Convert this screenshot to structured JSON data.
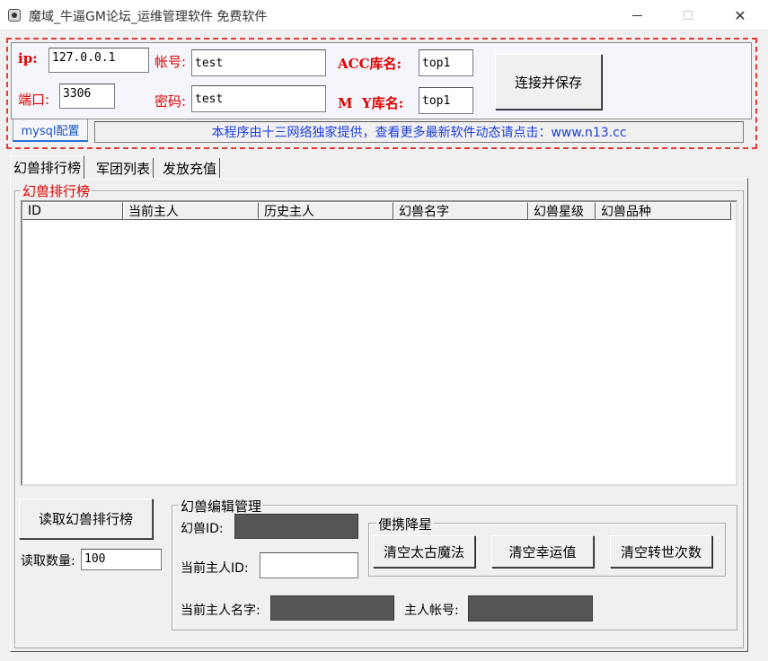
{
  "window": {
    "title": "魔域_牛逼GM论坛_运维管理软件   免费软件",
    "min_glyph": "",
    "close_glyph": "✕"
  },
  "config": {
    "ip_label": "ip:",
    "ip_value": "127.0.0.1",
    "port_label": "端口:",
    "port_value": "3306",
    "account_label": "帐号:",
    "account_value": "test",
    "password_label": "密码:",
    "password_value": "test",
    "acc_db_label": "ACC库名:",
    "acc_db_value": "top1",
    "m_db_label": "M  Y库名:",
    "m_db_value": "top1",
    "connect_button": "连接并保存",
    "mysql_tab": "mysql配置",
    "notice": "本程序由十三网络独家提供，查看更多最新软件动态请点击：www.n13.cc"
  },
  "tabs": [
    {
      "label": "幻兽排行榜",
      "active": true
    },
    {
      "label": "军团列表",
      "active": false
    },
    {
      "label": "发放充值",
      "active": false
    }
  ],
  "ranking": {
    "group_title": "幻兽排行榜",
    "columns": [
      "ID",
      "当前主人",
      "历史主人",
      "幻兽名字",
      "幻兽星级",
      "幻兽品种"
    ],
    "rows": []
  },
  "read": {
    "button": "读取幻兽排行榜",
    "count_label": "读取数量:",
    "count_value": "100"
  },
  "edit": {
    "group_title": "幻兽编辑管理",
    "pet_id_label": "幻兽ID:",
    "pet_id_value": "",
    "owner_id_label": "当前主人ID:",
    "owner_id_value": "",
    "owner_name_label": "当前主人名字:",
    "owner_name_value": "",
    "owner_account_label": "主人帐号:",
    "owner_account_value": ""
  },
  "downgrade": {
    "group_title": "便携降星",
    "buttons": [
      "清空太古魔法",
      "清空幸运值",
      "清空转世次数"
    ]
  }
}
